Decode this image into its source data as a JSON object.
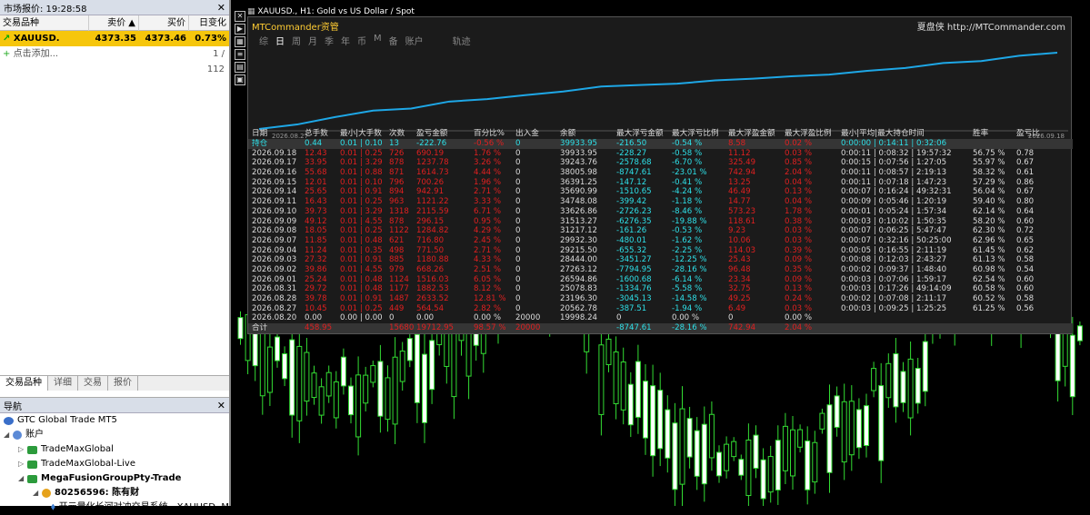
{
  "market_watch": {
    "title": "市场报价: 19:28:58",
    "cols": [
      "交易品种",
      "卖价",
      "买价",
      "日变化"
    ],
    "rows": [
      {
        "sym": "XAUUSD.",
        "bid": "4373.35",
        "ask": "4373.46",
        "chg": "0.73%"
      }
    ],
    "add_label": "点击添加...",
    "count": "1 / 112"
  },
  "tabs": [
    "交易品种",
    "详细",
    "交易",
    "报价"
  ],
  "navigator": {
    "title": "导航",
    "items": [
      "GTC Global Trade MT5",
      "账户",
      "TradeMaxGlobal",
      "TradeMaxGlobal-Live",
      "MegaFusionGroupPty-Trade",
      "80256596: 陈有财",
      "开元量化长河对冲交易系统 - XAUUSD.,M"
    ]
  },
  "chart": {
    "title": "XAUUSD., H1: Gold vs US Dollar / Spot"
  },
  "mt": {
    "title": "MTCommander资管",
    "site": "夏盘侠 http://MTCommander.com",
    "tabs": [
      "综",
      "日",
      "周",
      "月",
      "季",
      "年",
      "币",
      "M",
      "备",
      "账户",
      "轨迹"
    ],
    "active_tab": "日",
    "eq_start": "2026.08.27",
    "eq_end": "2026.09.18",
    "headers": [
      "日期",
      "总手数",
      "最小|大手数",
      "次数",
      "盈亏金额",
      "百分比%",
      "出入金",
      "余额",
      "最大浮亏金额",
      "最大浮亏比例",
      "最大浮盈金额",
      "最大浮盈比例",
      "最小|平均|最大持仓时间",
      "胜率",
      "盈亏比"
    ],
    "rows": [
      [
        "持仓",
        "0.44",
        "0.01 | 0.10",
        "13",
        "-222.76",
        "-0.56 %",
        "0",
        "39933.95",
        "-216.50",
        "-0.54 %",
        "8.58",
        "0.02 %",
        "0:00:00 | 0:14:11 | 0:32:06",
        "",
        ""
      ],
      [
        "2026.09.18",
        "12.43",
        "0.01 | 0.25",
        "726",
        "690.19",
        "1.76 %",
        "0",
        "39933.95",
        "-228.27",
        "-0.58 %",
        "11.12",
        "0.03 %",
        "0:00:11 | 0:08:32 | 19:57:32",
        "56.75 %",
        "0.78"
      ],
      [
        "2026.09.17",
        "33.95",
        "0.01 | 3.29",
        "878",
        "1237.78",
        "3.26 %",
        "0",
        "39243.76",
        "-2578.68",
        "-6.70 %",
        "325.49",
        "0.85 %",
        "0:00:15 | 0:07:56 | 1:27:05",
        "55.97 %",
        "0.67"
      ],
      [
        "2026.09.16",
        "55.68",
        "0.01 | 0.88",
        "871",
        "1614.73",
        "4.44 %",
        "0",
        "38005.98",
        "-8747.61",
        "-23.01 %",
        "742.94",
        "2.04 %",
        "0:00:11 | 0:08:57 | 2:19:13",
        "58.32 %",
        "0.61"
      ],
      [
        "2026.09.15",
        "12.01",
        "0.01 | 0.10",
        "796",
        "700.26",
        "1.96 %",
        "0",
        "36391.25",
        "-147.12",
        "-0.41 %",
        "13.25",
        "0.04 %",
        "0:00:11 | 0:07:18 | 1:47:23",
        "57.29 %",
        "0.86"
      ],
      [
        "2026.09.14",
        "25.65",
        "0.01 | 0.91",
        "894",
        "942.91",
        "2.71 %",
        "0",
        "35690.99",
        "-1510.65",
        "-4.24 %",
        "46.49",
        "0.13 %",
        "0:00:07 | 0:16:24 | 49:32:31",
        "56.04 %",
        "0.67"
      ],
      [
        "2026.09.11",
        "16.43",
        "0.01 | 0.25",
        "963",
        "1121.22",
        "3.33 %",
        "0",
        "34748.08",
        "-399.42",
        "-1.18 %",
        "14.77",
        "0.04 %",
        "0:00:09 | 0:05:46 | 1:20:19",
        "59.40 %",
        "0.80"
      ],
      [
        "2026.09.10",
        "39.73",
        "0.01 | 3.29",
        "1318",
        "2115.59",
        "6.71 %",
        "0",
        "33626.86",
        "-2726.23",
        "-8.46 %",
        "573.23",
        "1.78 %",
        "0:00:01 | 0:05:24 | 1:57:34",
        "62.14 %",
        "0.64"
      ],
      [
        "2026.09.09",
        "49.12",
        "0.01 | 4.55",
        "878",
        "296.15",
        "0.95 %",
        "0",
        "31513.27",
        "-6276.35",
        "-19.88 %",
        "118.61",
        "0.38 %",
        "0:00:03 | 0:10:02 | 1:50:35",
        "58.20 %",
        "0.60"
      ],
      [
        "2026.09.08",
        "18.05",
        "0.01 | 0.25",
        "1122",
        "1284.82",
        "4.29 %",
        "0",
        "31217.12",
        "-161.26",
        "-0.53 %",
        "9.23",
        "0.03 %",
        "0:00:07 | 0:06:25 | 5:47:47",
        "62.30 %",
        "0.72"
      ],
      [
        "2026.09.07",
        "11.85",
        "0.01 | 0.48",
        "621",
        "716.80",
        "2.45 %",
        "0",
        "29932.30",
        "-480.01",
        "-1.62 %",
        "10.06",
        "0.03 %",
        "0:00:07 | 0:32:16 | 50:25:00",
        "62.96 %",
        "0.65"
      ],
      [
        "2026.09.04",
        "11.24",
        "0.01 | 0.35",
        "498",
        "771.50",
        "2.71 %",
        "0",
        "29215.50",
        "-655.32",
        "-2.25 %",
        "114.03",
        "0.39 %",
        "0:00:05 | 0:16:55 | 2:11:19",
        "61.45 %",
        "0.62"
      ],
      [
        "2026.09.03",
        "27.32",
        "0.01 | 0.91",
        "885",
        "1180.88",
        "4.33 %",
        "0",
        "28444.00",
        "-3451.27",
        "-12.25 %",
        "25.43",
        "0.09 %",
        "0:00:08 | 0:12:03 | 2:43:27",
        "61.13 %",
        "0.58"
      ],
      [
        "2026.09.02",
        "39.86",
        "0.01 | 4.55",
        "979",
        "668.26",
        "2.51 %",
        "0",
        "27263.12",
        "-7794.95",
        "-28.16 %",
        "96.48",
        "0.35 %",
        "0:00:02 | 0:09:37 | 1:48:40",
        "60.98 %",
        "0.54"
      ],
      [
        "2026.09.01",
        "25.24",
        "0.01 | 0.48",
        "1124",
        "1516.03",
        "6.05 %",
        "0",
        "26594.86",
        "-1600.68",
        "-6.14 %",
        "23.34",
        "0.09 %",
        "0:00:03 | 0:07:06 | 1:59:17",
        "62.54 %",
        "0.60"
      ],
      [
        "2026.08.31",
        "29.72",
        "0.01 | 0.48",
        "1177",
        "1882.53",
        "8.12 %",
        "0",
        "25078.83",
        "-1334.76",
        "-5.58 %",
        "32.75",
        "0.13 %",
        "0:00:03 | 0:17:26 | 49:14:09",
        "60.58 %",
        "0.60"
      ],
      [
        "2026.08.28",
        "39.78",
        "0.01 | 0.91",
        "1487",
        "2633.52",
        "12.81 %",
        "0",
        "23196.30",
        "-3045.13",
        "-14.58 %",
        "49.25",
        "0.24 %",
        "0:00:02 | 0:07:08 | 2:11:17",
        "60.52 %",
        "0.58"
      ],
      [
        "2026.08.27",
        "10.45",
        "0.01 | 0.25",
        "449",
        "564.54",
        "2.82 %",
        "0",
        "20562.78",
        "-387.51",
        "-1.94 %",
        "6.49",
        "0.03 %",
        "0:00:03 | 0:09:25 | 1:25:25",
        "61.25 %",
        "0.56"
      ],
      [
        "2026.08.20",
        "0.00",
        "0.00 | 0.00",
        "0",
        "0.00",
        "0.00 %",
        "20000",
        "19998.24",
        "0",
        "0.00 %",
        "0",
        "0.00 %",
        "",
        "",
        ""
      ],
      [
        "合计",
        "458.95",
        "",
        "15680",
        "19712.95",
        "98.57 %",
        "20000",
        "",
        "-8747.61",
        "-28.16 %",
        "742.94",
        "2.04 %",
        "",
        "",
        ""
      ]
    ]
  },
  "equity_curve": [
    0,
    3.1,
    8.2,
    12.7,
    14.1,
    18.9,
    20.6,
    23.3,
    25.8,
    29.3,
    30.3,
    31.2,
    33.5,
    34.7,
    36.3,
    37.5,
    40.1,
    42.0,
    45.5,
    46.8,
    50.5,
    52.6
  ]
}
